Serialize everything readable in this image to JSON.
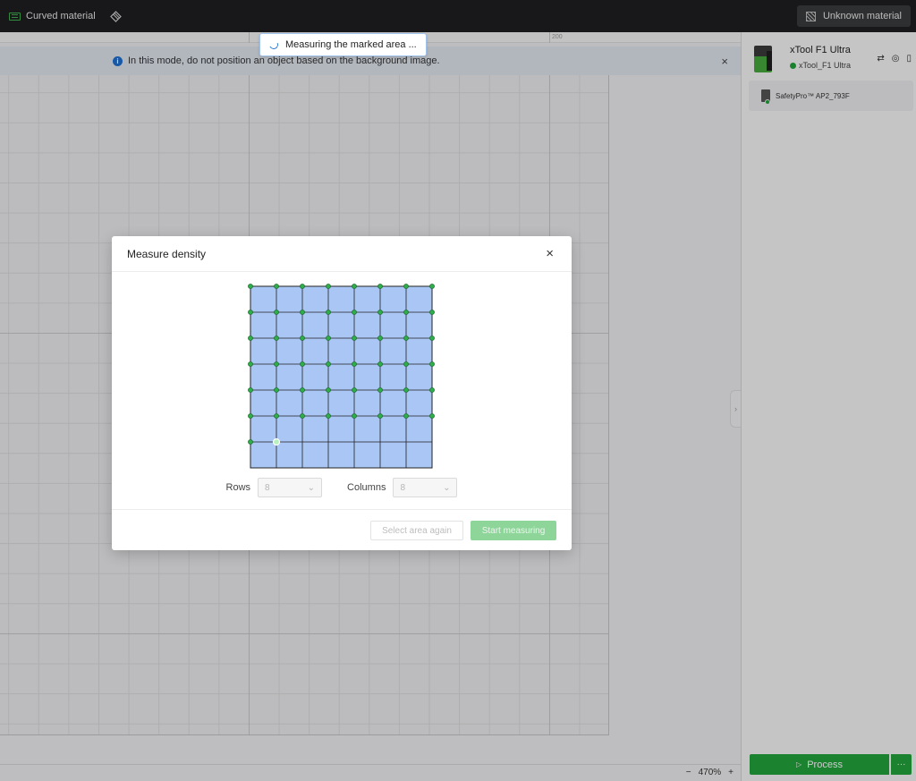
{
  "topbar": {
    "mode_icon": "curved-material-icon",
    "mode_label": "Curved material",
    "layers_icon": "layers-icon",
    "material_label": "Unknown material"
  },
  "canvas": {
    "ruler_tick": "200",
    "info_text": "In this mode, do not position an object based on the background image.",
    "info_icon": "i",
    "info_close": "×",
    "toast_text": "Measuring the marked area ..."
  },
  "device": {
    "name": "xTool F1 Ultra",
    "status": "xTool_F1 Ultra",
    "status_color": "#1fa33a",
    "accessory": "SafetyPro™ AP2_793F"
  },
  "process": {
    "label": "Process",
    "play_glyph": "▷",
    "more_glyph": "···",
    "color": "#22a33c"
  },
  "zoom": {
    "minus": "−",
    "level": "470%",
    "plus": "+"
  },
  "dialog": {
    "title": "Measure density",
    "close": "×",
    "grid": {
      "rows": 7,
      "columns": 7,
      "measured_points_full_rows": 6,
      "last_row_points": 2,
      "cell_fill": "#a9c6f5",
      "point_color": "#2fae4a"
    },
    "rows_label": "Rows",
    "rows_value": "8",
    "columns_label": "Columns",
    "columns_value": "8",
    "select_again": "Select area again",
    "start_measuring": "Start measuring"
  }
}
